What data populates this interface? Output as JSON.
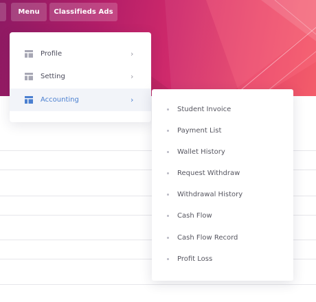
{
  "topnav": {
    "menu_label": "Menu",
    "classifieds_label": "Classifieds Ads"
  },
  "dropdown": {
    "items": [
      {
        "label": "Profile",
        "icon": "grid-icon",
        "active": false
      },
      {
        "label": "Setting",
        "icon": "grid-icon",
        "active": false
      },
      {
        "label": "Accounting",
        "icon": "grid-icon",
        "active": true
      }
    ]
  },
  "submenu": {
    "items": [
      {
        "label": "Student Invoice"
      },
      {
        "label": "Payment List"
      },
      {
        "label": "Wallet History"
      },
      {
        "label": "Request Withdraw"
      },
      {
        "label": "Withdrawal History"
      },
      {
        "label": "Cash Flow"
      },
      {
        "label": "Cash Flow Record"
      },
      {
        "label": "Profit Loss"
      }
    ]
  },
  "colors": {
    "accent": "#4a7fd0",
    "banner_start": "#8e1a63",
    "banner_end": "#f35d6a"
  }
}
